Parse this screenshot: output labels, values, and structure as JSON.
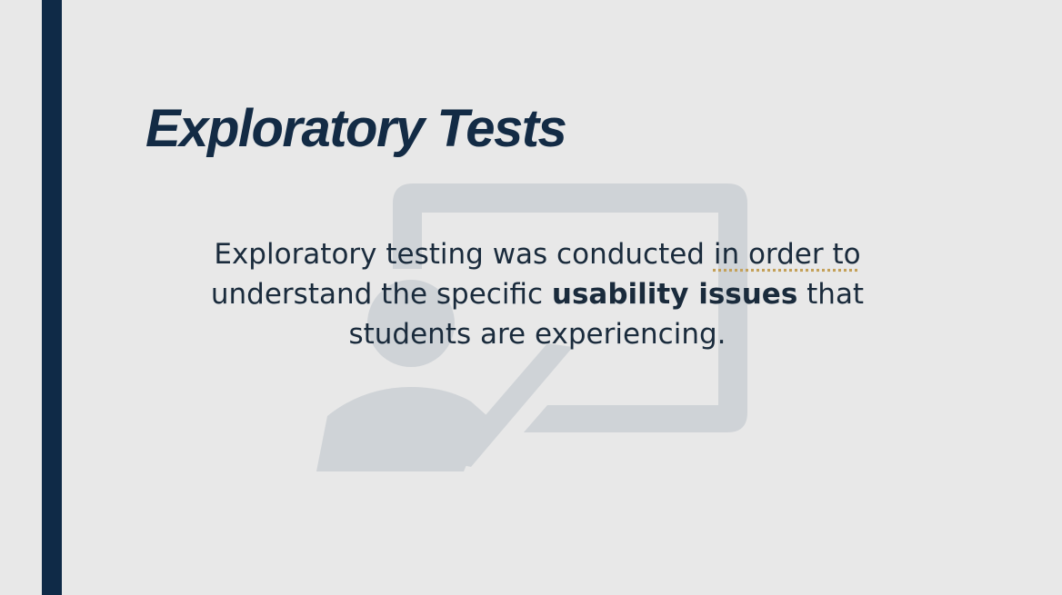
{
  "slide": {
    "title": "Exploratory Tests",
    "body": {
      "part1": "Exploratory testing was conducted ",
      "part2_underlined": "in order to",
      "part3": " understand the specific ",
      "part4_bold": "usability issues",
      "part5": " that students are experiencing."
    },
    "illustration_icon": "presenter-at-whiteboard-icon"
  },
  "colors": {
    "background": "#e8e8e8",
    "accent_bar": "#0f2a47",
    "title": "#132b45",
    "body_text": "#1a2b3c",
    "illustration": "#cfd3d7"
  }
}
